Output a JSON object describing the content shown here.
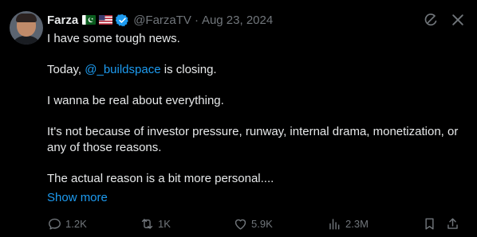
{
  "author": {
    "name": "Farza",
    "handle": "@FarzaTV",
    "separator": "·",
    "date": "Aug 23, 2024"
  },
  "body": {
    "line1": "I have some tough news.",
    "line2_prefix": "Today,",
    "line2_mention": "@_buildspace",
    "line2_suffix": "is closing.",
    "line3": "I wanna be real about everything.",
    "line4": "It's not because of investor pressure, runway, internal drama, monetization, or any of those reasons.",
    "line5": "The actual reason is a bit more personal...."
  },
  "show_more": "Show more",
  "stats": {
    "replies": "1.2K",
    "reposts": "1K",
    "likes": "5.9K",
    "views": "2.3M"
  },
  "icons": {
    "top": [
      "grok-icon",
      "close-icon"
    ],
    "actions": [
      "reply-icon",
      "repost-icon",
      "like-icon",
      "views-icon",
      "bookmark-icon",
      "share-icon"
    ]
  },
  "colors": {
    "background": "#000000",
    "text": "#e7e9ea",
    "muted": "#71767b",
    "accent": "#1d9bf0"
  }
}
